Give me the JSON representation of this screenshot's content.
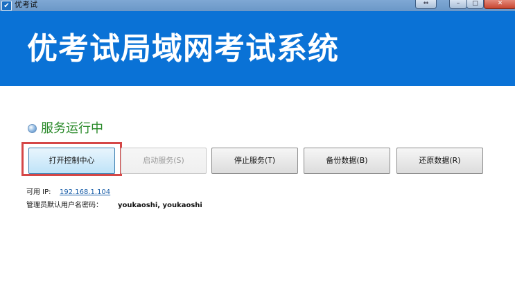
{
  "window": {
    "title": "优考试",
    "app_icon": "✔",
    "restore_icon": "⇔",
    "minimize_icon": "–",
    "maximize_icon": "□",
    "close_icon": "✕"
  },
  "banner": {
    "title": "优考试局域网考试系统",
    "background_color": "#0a72d6"
  },
  "status": {
    "text": "服务运行中",
    "color": "#2a8a2a"
  },
  "buttons": {
    "open_control_center": "打开控制中心",
    "start_service": "启动服务(S)",
    "stop_service": "停止服务(T)",
    "backup_data": "备份数据(B)",
    "restore_data": "还原数据(R)"
  },
  "info": {
    "ip_label": "可用 IP:",
    "ip_value": "192.168.1.104",
    "admin_label": "管理员默认用户名密码：",
    "admin_value": "youkaoshi, youkaoshi"
  },
  "highlight_color": "#d54747"
}
